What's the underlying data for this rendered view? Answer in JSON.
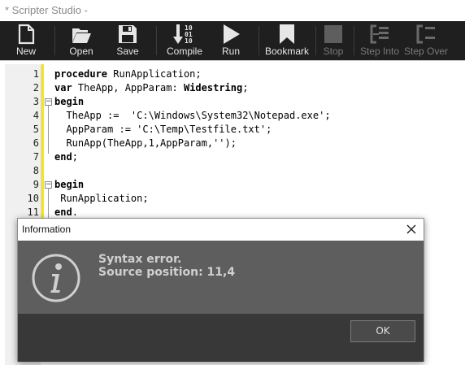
{
  "window": {
    "title": "* Scripter Studio -"
  },
  "toolbar": {
    "buttons": [
      {
        "label": "New",
        "icon": "new-file-icon",
        "enabled": true
      },
      {
        "label": "Open",
        "icon": "folder-open-icon",
        "enabled": true
      },
      {
        "label": "Save",
        "icon": "floppy-disk-icon",
        "enabled": true
      },
      {
        "label": "Compile",
        "icon": "compile-binary-icon",
        "enabled": true
      },
      {
        "label": "Run",
        "icon": "play-icon",
        "enabled": true
      },
      {
        "label": "Bookmark",
        "icon": "bookmark-icon",
        "enabled": true
      },
      {
        "label": "Stop",
        "icon": "stop-icon",
        "enabled": false
      },
      {
        "label": "Step Into",
        "icon": "step-into-icon",
        "enabled": false
      },
      {
        "label": "Step Over",
        "icon": "step-over-icon",
        "enabled": false
      }
    ]
  },
  "editor": {
    "line_numbers": [
      "1",
      "2",
      "3",
      "4",
      "5",
      "6",
      "7",
      "8",
      "9",
      "10",
      "11"
    ],
    "lines": [
      "procedure RunApplication;",
      "var TheApp, AppParam: Widestring;",
      "begin",
      "  TheApp :=  'C:\\Windows\\System32\\Notepad.exe';",
      "  AppParam := 'C:\\Temp\\Testfile.txt';",
      "  RunApp(TheApp,1,AppParam,'');",
      "end;",
      "",
      "begin",
      " RunApplication;",
      "end."
    ]
  },
  "dialog": {
    "title": "Information",
    "message_line1": "Syntax error.",
    "message_line2": "Source position: 11,4",
    "ok_label": "OK",
    "icon": "information-icon"
  }
}
